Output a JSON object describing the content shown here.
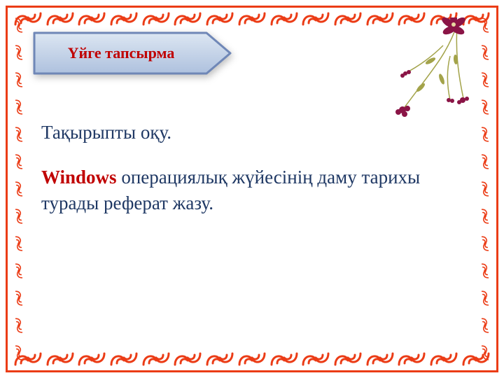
{
  "banner": {
    "title": "Үйге тапсырма"
  },
  "content": {
    "line1": "Тақырыпты оқу.",
    "line2_emphasis": "Windows",
    "line2_rest": "  операциялық жүйесінің даму тарихы турады реферат жазу."
  },
  "colors": {
    "ornament": "#eb3c16",
    "banner_stroke": "#6f87b7",
    "banner_fill_top": "#dce6f2",
    "banner_fill_bottom": "#aec1de",
    "title_text": "#c00000",
    "body_text": "#1f3864",
    "flower_petal": "#8a1446",
    "flower_stem": "#a3a34a"
  }
}
